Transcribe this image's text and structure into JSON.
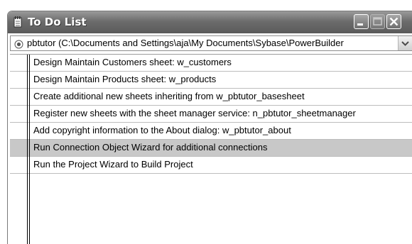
{
  "window": {
    "title": "To Do List"
  },
  "combo": {
    "selected_value": "pbtutor (C:\\Documents and Settings\\aja\\My Documents\\Sybase\\PowerBuilder",
    "icon": "radio-target-icon"
  },
  "todo": {
    "items": [
      "Design Maintain Customers sheet: w_customers",
      "Design Maintain Products sheet: w_products",
      "Create additional new sheets inheriting from w_pbtutor_basesheet",
      "Register new sheets with the sheet manager service: n_pbtutor_sheetmanager",
      "Add copyright information to the About dialog: w_pbtutor_about",
      "Run Connection Object Wizard for additional connections",
      "Run the Project Wizard to Build Project"
    ],
    "selected_index": 5
  },
  "colors": {
    "titlebar": "#6c6c6c",
    "selection": "#c8c8c8",
    "title_text": "#ffffff"
  }
}
